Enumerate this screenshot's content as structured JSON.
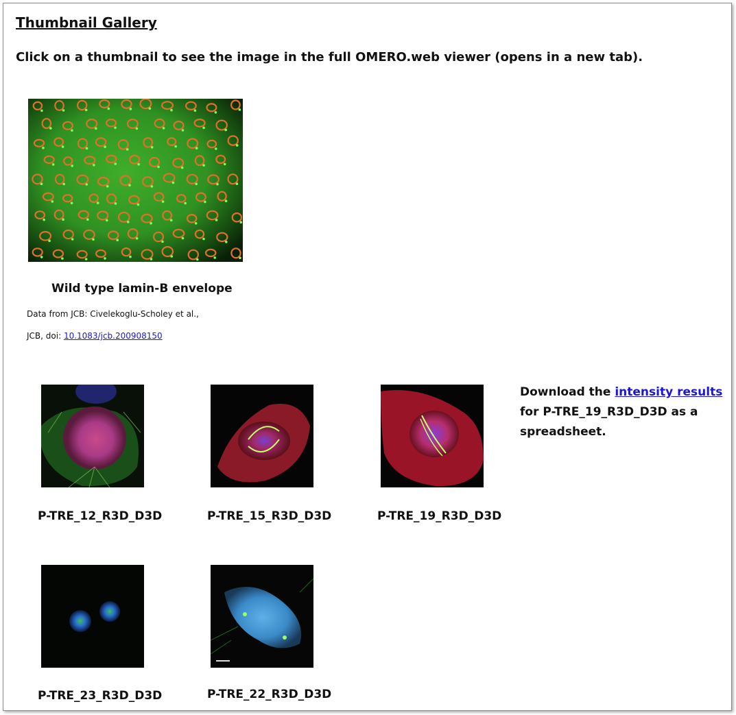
{
  "gallery": {
    "title": "Thumbnail Gallery",
    "intro": "Click on a thumbnail to see the image in the full OMERO.web viewer (opens in a new tab).",
    "featured": {
      "caption": "Wild type lamin-B envelope",
      "credit_line1": "Data from JCB: Civelekoglu-Scholey et al.,",
      "credit_line2_prefix": "JCB, doi: ",
      "doi_link": "10.1083/jcb.200908150"
    },
    "thumbnails": [
      {
        "label": "P-TRE_12_R3D_D3D"
      },
      {
        "label": "P-TRE_15_R3D_D3D"
      },
      {
        "label": "P-TRE_19_R3D_D3D"
      },
      {
        "label": "P-TRE_23_R3D_D3D"
      },
      {
        "label": "P-TRE_22_R3D_D3D"
      }
    ],
    "download": {
      "prefix": "Download the ",
      "link": "intensity results",
      "suffix": " for P-TRE_19_R3D_D3D as a spreadsheet."
    }
  },
  "colors": {
    "link": "#1a16d8",
    "border": "#8a8a8a"
  }
}
